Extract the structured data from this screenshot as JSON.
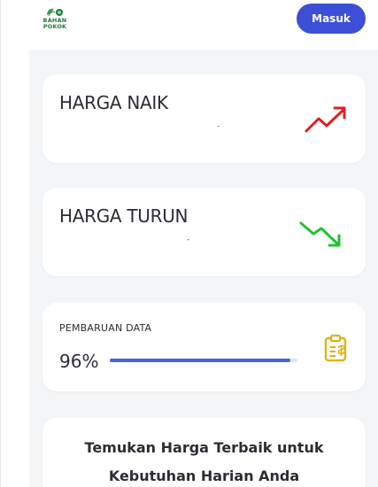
{
  "header": {
    "logo_text_line1": "BAHAN",
    "logo_text_line2": "POKOK",
    "login_label": "Masuk"
  },
  "cards": {
    "price_up": {
      "title": "HARGA NAIK",
      "value": "-",
      "icon": "trend-up-icon",
      "color": "#e11d1d"
    },
    "price_down": {
      "title": "HARGA TURUN",
      "value": "-",
      "icon": "trend-down-icon",
      "color": "#22c12e"
    },
    "data_update": {
      "title": "PEMBARUAN DATA",
      "percent_label": "96%",
      "progress": 0.96,
      "icon": "clipboard-icon",
      "icon_color": "#e0b312",
      "bar_color": "#4a5fe0"
    }
  },
  "cta": {
    "line1": "Temukan Harga Terbaik untuk",
    "line2": "Kebutuhan Harian Anda"
  },
  "colors": {
    "accent": "#3d4fd6",
    "logo_green": "#1f7a3e",
    "background": "#f4f5f7"
  }
}
